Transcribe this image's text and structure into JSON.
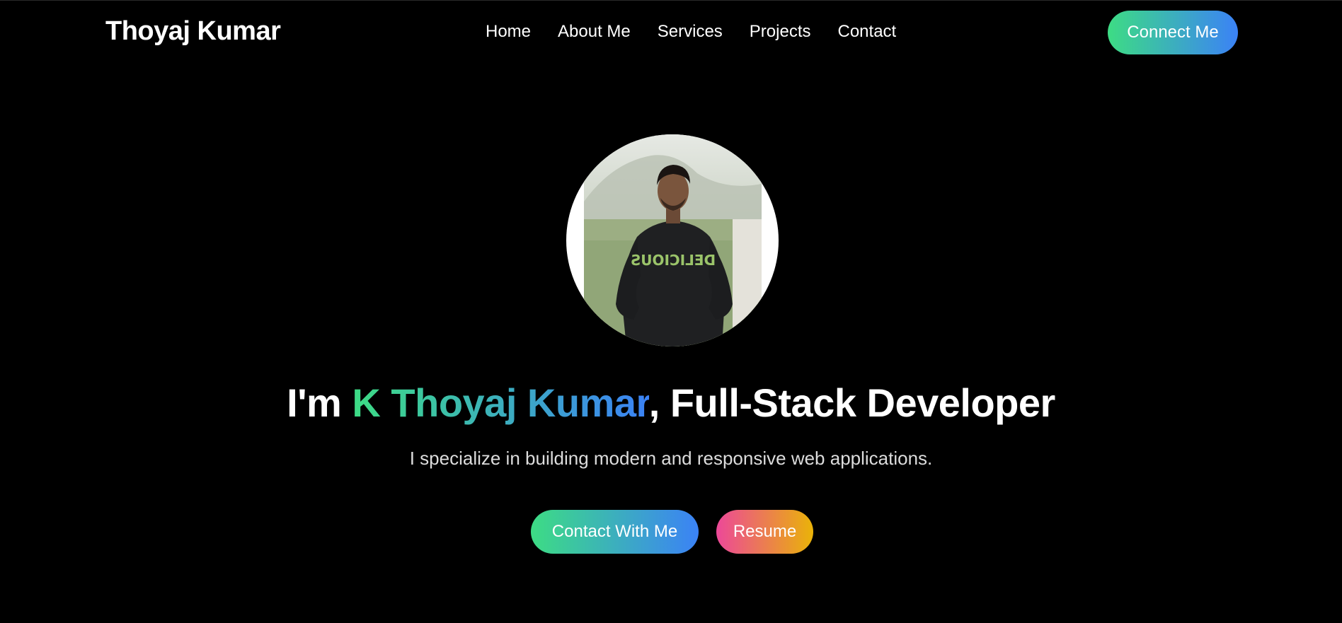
{
  "navbar": {
    "brand": "Thoyaj Kumar",
    "links": [
      "Home",
      "About Me",
      "Services",
      "Projects",
      "Contact"
    ],
    "cta_label": "Connect Me"
  },
  "hero": {
    "headline_prefix": "I'm ",
    "headline_name": "K Thoyaj Kumar",
    "headline_suffix": ", Full-Stack Developer",
    "subtitle": "I specialize in building modern and responsive web applications.",
    "primary_button": "Contact With Me",
    "secondary_button": "Resume"
  },
  "colors": {
    "background": "#000000",
    "gradient_green": "#3ddc84",
    "gradient_blue": "#3b82f6",
    "gradient_pink": "#ec4899",
    "gradient_amber": "#eab308"
  }
}
